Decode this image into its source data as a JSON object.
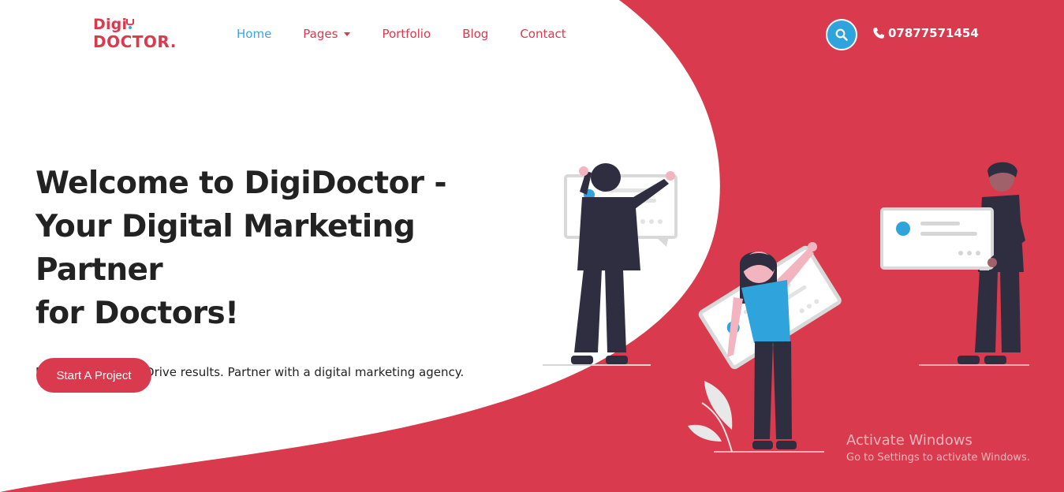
{
  "logo": {
    "line1": "Digi",
    "line1_accent": "",
    "line2": "DOCTOR."
  },
  "nav": {
    "items": [
      {
        "label": "Home",
        "active": true
      },
      {
        "label": "Pages",
        "dropdown": true
      },
      {
        "label": "Portfolio"
      },
      {
        "label": "Blog"
      },
      {
        "label": "Contact"
      }
    ]
  },
  "header": {
    "search_icon": "search-icon",
    "phone_icon": "phone-icon",
    "phone": "07877571454"
  },
  "hero": {
    "title_line1": "Welcome to DigiDoctor -",
    "title_line2": "Your Digital Marketing Partner",
    "title_line3": "for Doctors!",
    "subtitle": "Boost your brand. Drive results. Partner with a digital marketing agency.",
    "cta_label": "Start A Project"
  },
  "watermark": {
    "title": "Activate Windows",
    "subtitle": "Go to Settings to activate Windows."
  },
  "colors": {
    "brand_red": "#d93a4d",
    "accent_blue": "#2fa3dc",
    "text_dark": "#222222",
    "figure_dark": "#2f2e41"
  }
}
